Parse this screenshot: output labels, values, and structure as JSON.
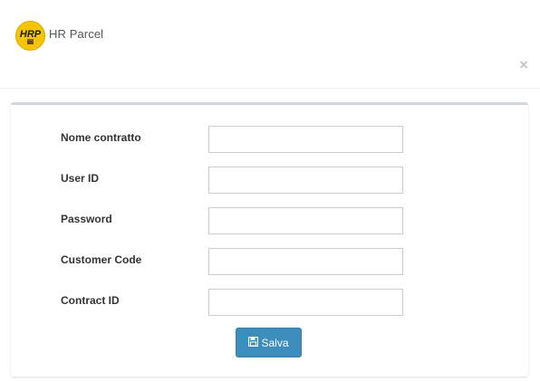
{
  "header": {
    "logo_text": "HRP",
    "brand_name": "HR Parcel",
    "close_glyph": "×"
  },
  "form": {
    "fields": [
      {
        "label": "Nome contratto",
        "value": ""
      },
      {
        "label": "User ID",
        "value": ""
      },
      {
        "label": "Password",
        "value": ""
      },
      {
        "label": "Customer Code",
        "value": ""
      },
      {
        "label": "Contract ID",
        "value": ""
      }
    ],
    "save_label": "Salva",
    "save_icon": "floppy-disk-icon"
  },
  "colors": {
    "primary_button": "#3c8dbc",
    "logo_yellow": "#f5c400",
    "panel_top_border": "#d2d6de"
  }
}
